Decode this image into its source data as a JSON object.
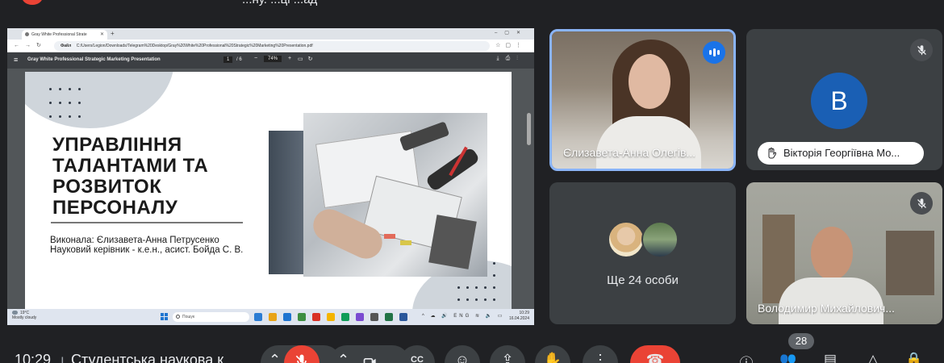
{
  "meeting": {
    "time": "10:29",
    "title": "Студентська наукова к",
    "top_title": "...ну. ...ці ...ад"
  },
  "browser": {
    "tab_title": "Gray White Professional Strate",
    "url": "C:/Users/Legion/Downloads/Telegram%20Desktop/Gray%20White%20Professional%20Strategic%20Marketing%20Presentation.pdf",
    "url_prefix": "Файл"
  },
  "pdf_viewer": {
    "doc_title": "Gray White Professional Strategic Marketing Presentation",
    "page_current": "1",
    "page_total": "/ 6",
    "zoom": "74%"
  },
  "slide": {
    "title_lines": [
      "УПРАВЛІННЯ",
      "ТАЛАНТАМИ ТА",
      "РОЗВИТОК",
      "ПЕРСОНАЛУ"
    ],
    "author_line1": "Виконала: Єлизавета-Анна Петрусенко",
    "author_line2": "Науковий керівник - к.е.н., асист. Бойда С. В."
  },
  "taskbar": {
    "weather_temp": "19°C",
    "weather_desc": "Mostly cloudy",
    "search_placeholder": "Пошук",
    "lang": "ENG",
    "clock_time": "10:29",
    "clock_date": "16.04.2024",
    "app_colors": [
      "#2b7cd3",
      "#e8a317",
      "#1e74d0",
      "#3e8e41",
      "#d93025",
      "#f4b400",
      "#0f9d58",
      "#7b4bd1",
      "#555555",
      "#217346",
      "#2b579a"
    ]
  },
  "participants": {
    "p1_name": "Єлизавета-Анна Олегів...",
    "p2_initial": "В",
    "p2_name": "Вікторія Георгіївна Мо...",
    "others_label": "Ще 24 особи",
    "p4_name": "Володимир Михайлович..."
  },
  "controls": {
    "participant_count": "28"
  },
  "colors": {
    "accent": "#8ab4f8",
    "danger": "#ea4335",
    "avatar_bg": "#1a5fb4",
    "speaking": "#1a73e8"
  }
}
